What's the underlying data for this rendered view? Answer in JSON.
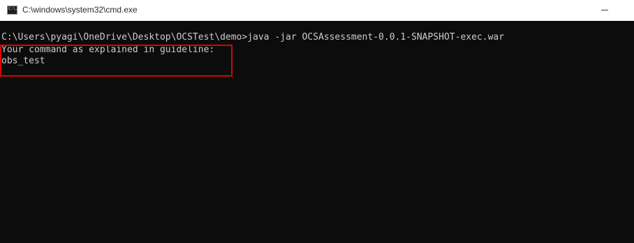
{
  "window": {
    "title": "C:\\windows\\system32\\cmd.exe",
    "app_icon_text": "C:\\.",
    "minimize_icon": "minimize-icon"
  },
  "console": {
    "lines": [
      "C:\\Users\\pyagi\\OneDrive\\Desktop\\OCSTest\\demo>java -jar OCSAssessment-0.0.1-SNAPSHOT-exec.war",
      "Your command as explained in guideline:",
      "obs_test"
    ]
  },
  "colors": {
    "console_background": "#0c0c0c",
    "console_text": "#cccccc",
    "highlight_border": "#e00000",
    "titlebar_background": "#ffffff"
  }
}
